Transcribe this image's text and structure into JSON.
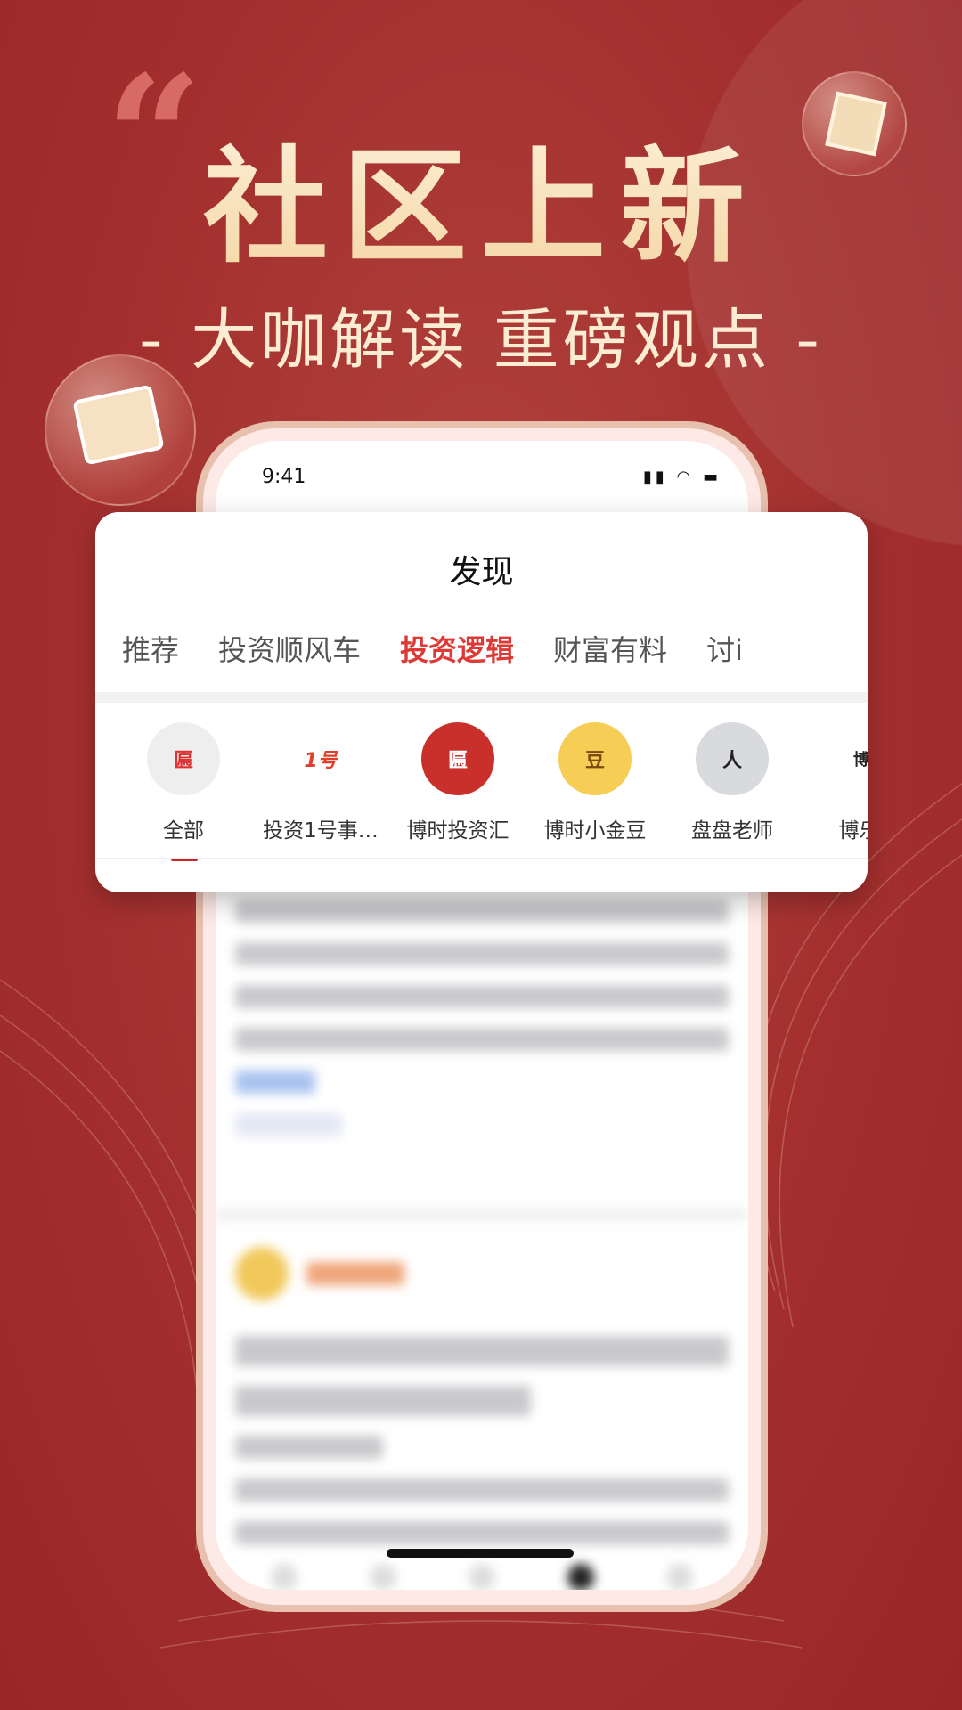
{
  "promo": {
    "title": "社区上新",
    "subtitle": "- 大咖解读 重磅观点 -"
  },
  "status_bar": {
    "time": "9:41",
    "icons": [
      "signal-icon",
      "wifi-icon",
      "battery-icon"
    ]
  },
  "page": {
    "title": "发现"
  },
  "tabs": [
    {
      "label": "推荐"
    },
    {
      "label": "投资顺风车"
    },
    {
      "label": "投资逻辑",
      "active": true
    },
    {
      "label": "财富有料"
    },
    {
      "label": "讨i"
    }
  ],
  "creators": [
    {
      "label": "全部",
      "logo": "匾",
      "active": true
    },
    {
      "label": "投资1号事…",
      "logo": "1号"
    },
    {
      "label": "博时投资汇",
      "logo": "匾"
    },
    {
      "label": "博时小金豆",
      "logo": "豆"
    },
    {
      "label": "盘盘老师",
      "logo": "人"
    },
    {
      "label": "博乐智",
      "logo": "博乐"
    }
  ],
  "colors": {
    "accent": "#dd3a36",
    "background": "#a3302e",
    "title_gold": "#f4d6a4"
  }
}
